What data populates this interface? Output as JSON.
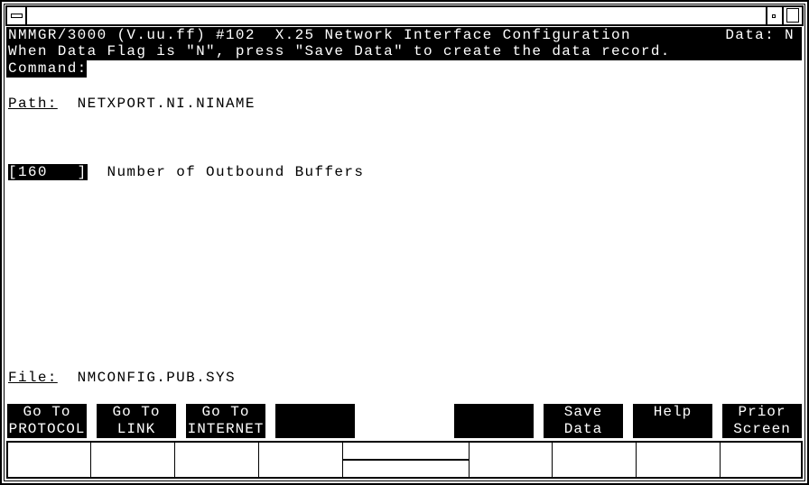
{
  "header": {
    "title": "NMMGR/3000 (V.uu.ff) #102  X.25 Network Interface Configuration",
    "data_flag_label": "Data: N",
    "instruction": "When Data Flag is \"N\", press \"Save Data\" to create the data record.",
    "command_label": "Command:",
    "command_value": ""
  },
  "path": {
    "label": "Path:",
    "value": "NETXPORT.NI.NINAME"
  },
  "fields": [
    {
      "value": "160",
      "label": "Number of Outbound Buffers"
    }
  ],
  "file": {
    "label": "File:",
    "value": "NMCONFIG.PUB.SYS"
  },
  "softkeys": [
    {
      "line1": "Go To",
      "line2": "PROTOCOL"
    },
    {
      "line1": "Go To",
      "line2": "LINK"
    },
    {
      "line1": "Go To",
      "line2": "INTERNET"
    },
    {
      "line1": "",
      "line2": ""
    },
    {
      "line1": "",
      "line2": ""
    },
    {
      "line1": "Save",
      "line2": "Data"
    },
    {
      "line1": "Help",
      "line2": ""
    },
    {
      "line1": "Prior",
      "line2": "Screen"
    }
  ],
  "window_icons": [
    "window-menu-icon",
    "minimize-icon",
    "maximize-icon"
  ]
}
